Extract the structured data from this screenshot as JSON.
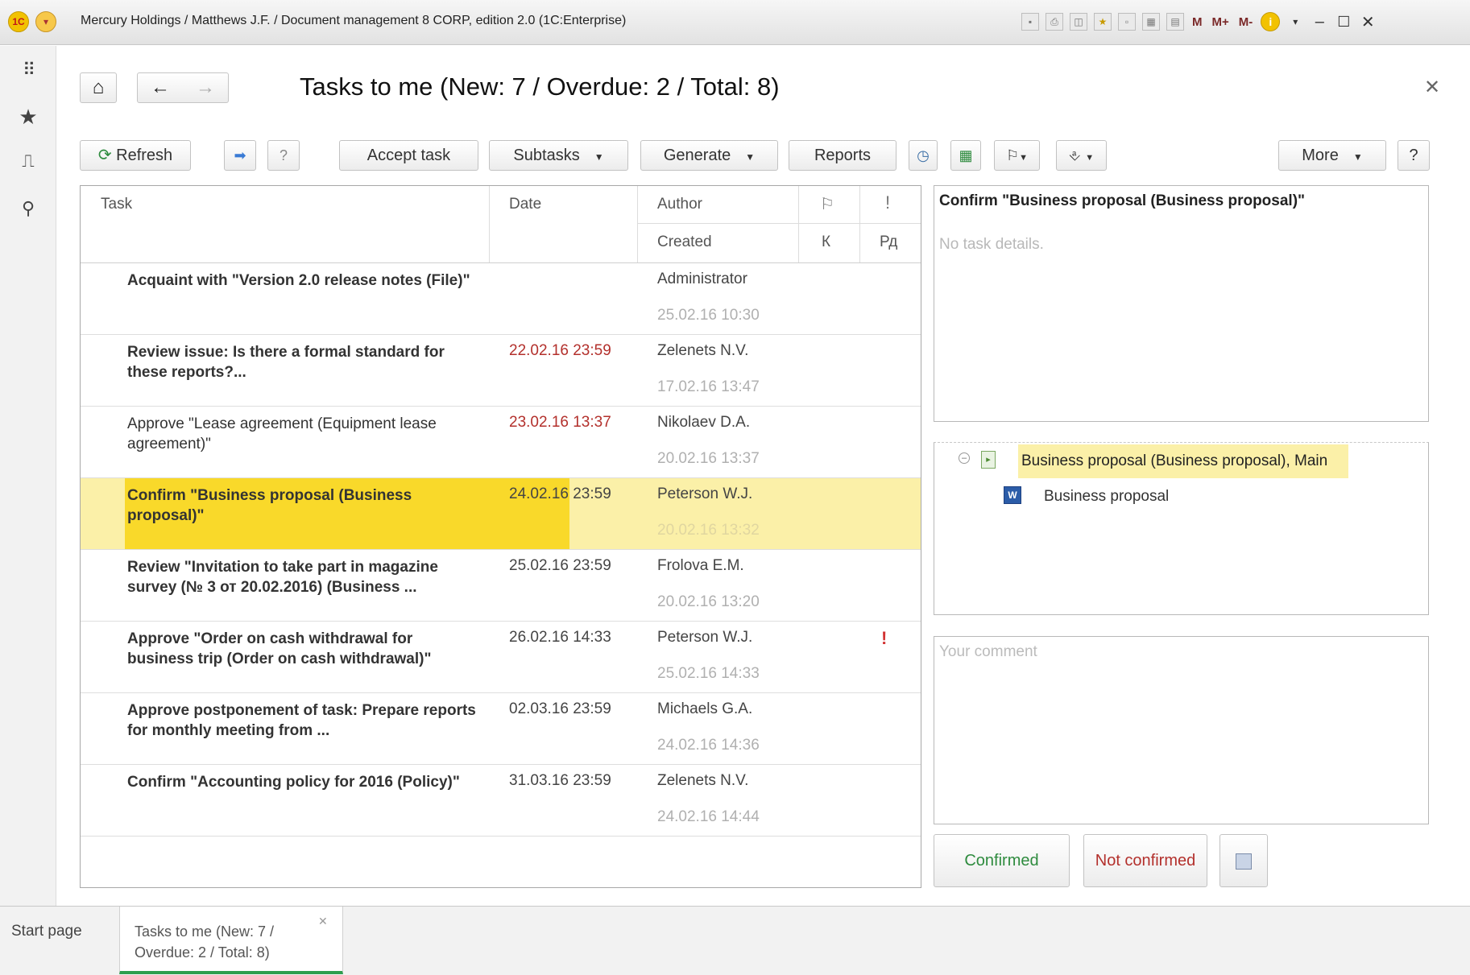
{
  "window": {
    "title": "Mercury Holdings / Matthews J.F. / Document management 8 CORP, edition 2.0  (1C:Enterprise)",
    "memory_buttons": [
      "M",
      "M+",
      "M-"
    ]
  },
  "form": {
    "title": "Tasks to me (New: 7 / Overdue: 2 / Total: 8)"
  },
  "toolbar": {
    "refresh": "Refresh",
    "accept_task": "Accept task",
    "subtasks": "Subtasks",
    "generate": "Generate",
    "reports": "Reports",
    "more": "More",
    "help": "?"
  },
  "table": {
    "headers": {
      "task": "Task",
      "date": "Date",
      "author": "Author",
      "created": "Created",
      "k": "К",
      "rd": "Рд"
    },
    "rows": [
      {
        "task": "Acquaint with \"Version 2.0 release notes (File)\"",
        "date": "",
        "author": "Administrator",
        "created": "25.02.16 10:30",
        "important": ""
      },
      {
        "task": "Review issue: Is there a formal standard for these reports?...",
        "date": "22.02.16 23:59",
        "author": "Zelenets N.V.",
        "created": "17.02.16 13:47",
        "important": ""
      },
      {
        "task": "Approve \"Lease agreement (Equipment lease agreement)\"",
        "date": "23.02.16 13:37",
        "author": "Nikolaev D.A.",
        "created": "20.02.16 13:37",
        "important": ""
      },
      {
        "task": "Confirm \"Business proposal (Business proposal)\"",
        "date": "24.02.16 23:59",
        "author": "Peterson W.J.",
        "created": "20.02.16 13:32",
        "important": ""
      },
      {
        "task": "Review \"Invitation to take part in magazine survey (№ 3 от 20.02.2016) (Business ...",
        "date": "25.02.16 23:59",
        "author": "Frolova E.M.",
        "created": "20.02.16 13:20",
        "important": ""
      },
      {
        "task": "Approve \"Order on cash withdrawal for business trip (Order on cash withdrawal)\"",
        "date": "26.02.16 14:33",
        "author": "Peterson W.J.",
        "created": "25.02.16 14:33",
        "important": "!"
      },
      {
        "task": "Approve postponement of task: Prepare reports for monthly meeting from ...",
        "date": "02.03.16 23:59",
        "author": "Michaels G.A.",
        "created": "24.02.16 14:36",
        "important": ""
      },
      {
        "task": "Confirm \"Accounting policy for 2016 (Policy)\"",
        "date": "31.03.16 23:59",
        "author": "Zelenets N.V.",
        "created": "24.02.16 14:44",
        "important": ""
      }
    ]
  },
  "detail": {
    "title": "Confirm \"Business proposal (Business proposal)\"",
    "empty_text": "No task details."
  },
  "tree": {
    "root_label": "Business proposal (Business proposal), Main",
    "child_label": "Business proposal"
  },
  "comment": {
    "placeholder": "Your comment"
  },
  "actions": {
    "confirmed": "Confirmed",
    "not_confirmed": "Not confirmed"
  },
  "tabs": {
    "start_page": "Start page",
    "active": "Tasks to me (New: 7 / Overdue: 2 / Total: 8)"
  },
  "colors": {
    "selection": "#f9d92a",
    "selection_row": "#fbf0a8",
    "overdue": "#b3302c",
    "confirmed": "#2e8b3e",
    "not_confirmed": "#b3302c",
    "active_tab": "#2e9e4e"
  }
}
